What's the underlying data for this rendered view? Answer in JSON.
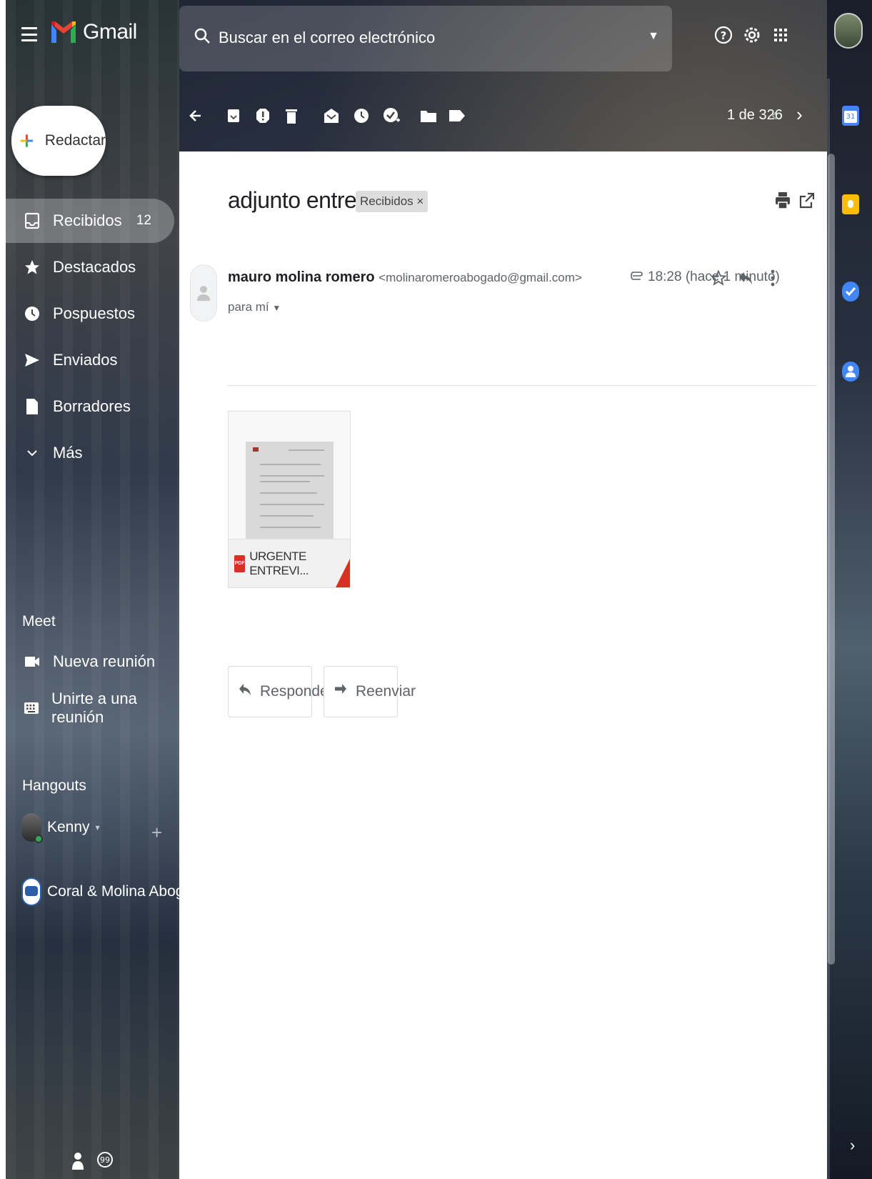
{
  "app": {
    "name": "Gmail"
  },
  "search": {
    "placeholder": "Buscar en el correo electrónico"
  },
  "toolbar": {
    "pager_text": "1 de 326"
  },
  "sidebar": {
    "compose_label": "Redactar",
    "items": [
      {
        "label": "Recibidos",
        "count": "12"
      },
      {
        "label": "Destacados"
      },
      {
        "label": "Pospuestos"
      },
      {
        "label": "Enviados"
      },
      {
        "label": "Borradores"
      },
      {
        "label": "Más"
      }
    ],
    "meet": {
      "title": "Meet",
      "items": [
        {
          "label": "Nueva reunión"
        },
        {
          "label": "Unirte a una reunión"
        }
      ]
    },
    "hangouts": {
      "title": "Hangouts",
      "contacts": [
        {
          "name": "Kenny"
        },
        {
          "name": "Coral & Molina Abogados"
        }
      ]
    }
  },
  "email": {
    "subject": "adjunto entrevista",
    "label": "Recibidos ×",
    "sender_name": "mauro molina romero",
    "sender_email": "<molinaromeroabogado@gmail.com>",
    "to": "para mí",
    "time": "18:28 (hace 1 minuto)",
    "attachment": {
      "name": "URGENTE ENTREVI...",
      "type_badge": "PDF"
    },
    "reply_label": "Responder",
    "forward_label": "Reenviar"
  },
  "colors": {
    "gmail_red": "#ea4335",
    "gmail_blue": "#4285f4",
    "gmail_yellow": "#fbbc04",
    "gmail_green": "#34a853",
    "pdf_red": "#d93025"
  }
}
